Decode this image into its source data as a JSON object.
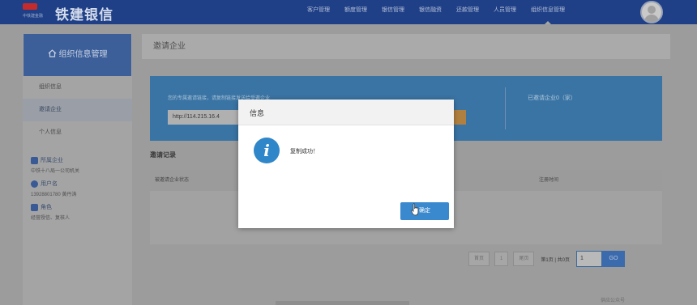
{
  "app": {
    "logo_sub": "中铁建金融",
    "title": "铁建银信"
  },
  "nav": {
    "items": [
      "客户管理",
      "额度管理",
      "银信管理",
      "银信融资",
      "还款管理",
      "人员管理",
      "组织信息管理"
    ],
    "active_index": 6
  },
  "sidebar": {
    "heading": "组织信息管理",
    "heading_icon": "home-icon",
    "items": [
      "组织信息",
      "邀请企业",
      "个人信息"
    ],
    "active_index": 1,
    "info": {
      "company_label": "所属企业",
      "company_value": "中铁十八局一公司机关",
      "username_label": "用户名",
      "username_value": "13928801780 黄丹涛",
      "role_label": "角色",
      "role_value": "经营授信、复核人"
    }
  },
  "main": {
    "title": "邀请企业",
    "banner": {
      "hint": "您的专属邀请链接，请复制链接发送给受邀企业",
      "url": "http://114.215.16.4",
      "invited_count": "已邀请企业0（家）"
    },
    "records_title": "邀请记录",
    "table": {
      "columns": [
        "被邀请企业状态",
        "注册时间"
      ]
    },
    "pager": {
      "first": "首页",
      "page": "1",
      "last": "尾页",
      "info": "第1页 | 共0页",
      "input_value": "1",
      "go": "GO"
    },
    "footer": "供应公众号"
  },
  "modal": {
    "title": "信息",
    "icon": "info-icon",
    "message": "复制成功！",
    "confirm": "确定"
  },
  "colors": {
    "nav_bg": "#1f3f86",
    "accent": "#3a89ce",
    "sidebar_head": "#3c5f99",
    "banner": "#3a74a4"
  }
}
